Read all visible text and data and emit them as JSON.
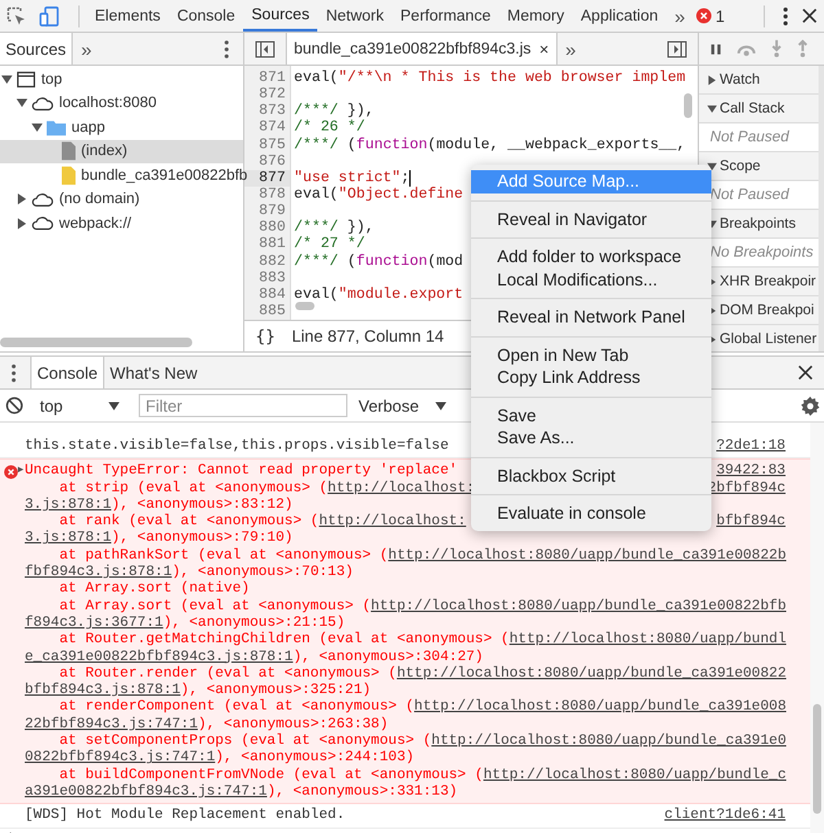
{
  "main_tabs": [
    {
      "label": "Elements",
      "selected": false
    },
    {
      "label": "Console",
      "selected": false
    },
    {
      "label": "Sources",
      "selected": true
    },
    {
      "label": "Network",
      "selected": false
    },
    {
      "label": "Performance",
      "selected": false
    },
    {
      "label": "Memory",
      "selected": false
    },
    {
      "label": "Application",
      "selected": false
    }
  ],
  "more_tabs": "»",
  "error_count": "1",
  "navigator": {
    "tab": "Sources",
    "more": "»",
    "tree": [
      {
        "label": "top",
        "kind": "frame",
        "expanded": true,
        "selected": false,
        "children": [
          {
            "label": "localhost:8080",
            "kind": "cloud",
            "expanded": true,
            "selected": false,
            "children": [
              {
                "label": "uapp",
                "kind": "folder",
                "expanded": true,
                "selected": false,
                "children": [
                  {
                    "label": "(index)",
                    "kind": "document",
                    "selected": true
                  },
                  {
                    "label": "bundle_ca391e00822bfb",
                    "kind": "script",
                    "selected": false
                  }
                ]
              }
            ]
          },
          {
            "label": "(no domain)",
            "kind": "cloud",
            "expanded": false,
            "selected": false
          },
          {
            "label": "webpack://",
            "kind": "cloud",
            "expanded": false,
            "selected": false
          }
        ]
      }
    ]
  },
  "editor": {
    "file_tab": "bundle_ca391e00822bfbf894c3.js",
    "close": "×",
    "more": "»",
    "lines": [
      {
        "number": "871",
        "cursor": false,
        "segments": [
          {
            "kind": "plain",
            "text": "eval("
          },
          {
            "kind": "string",
            "text": "\"/**\\n * This is the web browser implem"
          }
        ]
      },
      {
        "number": "872",
        "cursor": false
      },
      {
        "number": "873",
        "cursor": false,
        "segments": [
          {
            "kind": "comment",
            "text": "/***/"
          },
          {
            "kind": "plain",
            "text": " }),"
          }
        ]
      },
      {
        "number": "874",
        "cursor": false,
        "segments": [
          {
            "kind": "comment",
            "text": "/* 26 */"
          }
        ]
      },
      {
        "number": "875",
        "cursor": false,
        "segments": [
          {
            "kind": "comment",
            "text": "/***/"
          },
          {
            "kind": "plain",
            "text": " ("
          },
          {
            "kind": "keyword",
            "text": "function"
          },
          {
            "kind": "plain",
            "text": "(module, __webpack_exports__,"
          }
        ]
      },
      {
        "number": "876",
        "cursor": false
      },
      {
        "number": "877",
        "cursor": true,
        "segments": [
          {
            "kind": "string",
            "text": "\"use strict\""
          },
          {
            "kind": "plain",
            "text": ";"
          }
        ]
      },
      {
        "number": "878",
        "cursor": false,
        "segments": [
          {
            "kind": "plain",
            "text": "eval("
          },
          {
            "kind": "string",
            "text": "\"Object.define"
          }
        ]
      },
      {
        "number": "879",
        "cursor": false
      },
      {
        "number": "880",
        "cursor": false,
        "segments": [
          {
            "kind": "comment",
            "text": "/***/"
          },
          {
            "kind": "plain",
            "text": " }),"
          }
        ]
      },
      {
        "number": "881",
        "cursor": false,
        "segments": [
          {
            "kind": "comment",
            "text": "/* 27 */"
          }
        ]
      },
      {
        "number": "882",
        "cursor": false,
        "segments": [
          {
            "kind": "comment",
            "text": "/***/"
          },
          {
            "kind": "plain",
            "text": " ("
          },
          {
            "kind": "keyword",
            "text": "function"
          },
          {
            "kind": "plain",
            "text": "(mod"
          }
        ]
      },
      {
        "number": "883",
        "cursor": false
      },
      {
        "number": "884",
        "cursor": false,
        "segments": [
          {
            "kind": "plain",
            "text": "eval("
          },
          {
            "kind": "string",
            "text": "\"module.export"
          }
        ]
      },
      {
        "number": "885",
        "cursor": false
      }
    ],
    "format_button": "{}",
    "status": "Line 877, Column 14"
  },
  "debugger": {
    "sections": [
      {
        "kind": "section",
        "label": "Watch",
        "expanded": false
      },
      {
        "kind": "section",
        "label": "Call Stack",
        "expanded": true
      },
      {
        "kind": "placeholder",
        "label": "Not Paused"
      },
      {
        "kind": "section",
        "label": "Scope",
        "expanded": true
      },
      {
        "kind": "placeholder",
        "label": "Not Paused"
      },
      {
        "kind": "section",
        "label": "Breakpoints",
        "expanded": true
      },
      {
        "kind": "placeholder",
        "label": "No Breakpoints"
      },
      {
        "kind": "section",
        "label": "XHR Breakpoir",
        "expanded": false
      },
      {
        "kind": "section",
        "label": "DOM Breakpoi",
        "expanded": false
      },
      {
        "kind": "section",
        "label": "Global Listener",
        "expanded": false
      }
    ]
  },
  "context_menu": [
    [
      {
        "label": "Add Source Map...",
        "selected": true
      }
    ],
    [
      {
        "label": "Reveal in Navigator",
        "selected": false
      }
    ],
    [
      {
        "label": "Add folder to workspace",
        "selected": false
      },
      {
        "label": "Local Modifications...",
        "selected": false
      }
    ],
    [
      {
        "label": "Reveal in Network Panel",
        "selected": false
      }
    ],
    [
      {
        "label": "Open in New Tab",
        "selected": false
      },
      {
        "label": "Copy Link Address",
        "selected": false
      }
    ],
    [
      {
        "label": "Save",
        "selected": false
      },
      {
        "label": "Save As...",
        "selected": false
      }
    ],
    [
      {
        "label": "Blackbox Script",
        "selected": false
      }
    ],
    [
      {
        "label": "Evaluate in console",
        "selected": false
      }
    ]
  ],
  "drawer": {
    "tabs": [
      {
        "label": "Console",
        "selected": true
      },
      {
        "label": "What's New",
        "selected": false
      }
    ],
    "context": "top",
    "filter": {
      "placeholder": "Filter"
    },
    "level": "Verbose",
    "messages": [
      {
        "kind": "log",
        "lines": [
          {
            "segments": [
              {
                "text": "this.state.visible=false,this.props.visible=false",
                "link": false
              }
            ],
            "right": "?2de1:18"
          }
        ]
      },
      {
        "kind": "error",
        "toggle": "▶",
        "lines": [
          {
            "segments": [
              {
                "text": "Uncaught TypeError: Cannot read property 'replace'",
                "link": false
              }
            ],
            "right": "39422:83"
          },
          {
            "segments": [
              {
                "text": "    at strip (eval at <anonymous> (",
                "link": false
              },
              {
                "text": "http://localhost:",
                "link": true
              }
            ],
            "right": "2bfbf894c"
          },
          {
            "segments": [
              {
                "text": "3.js:878:1",
                "link": true
              },
              {
                "text": "), <anonymous>:83:12)",
                "link": false
              }
            ]
          },
          {
            "segments": [
              {
                "text": "    at rank (eval at <anonymous> (",
                "link": false
              },
              {
                "text": "http://localhost:",
                "link": true
              }
            ],
            "right": "bfbf894c"
          },
          {
            "segments": [
              {
                "text": "3.js:878:1",
                "link": true
              },
              {
                "text": "), <anonymous>:79:10)",
                "link": false
              }
            ]
          },
          {
            "segments": [
              {
                "text": "    at pathRankSort (eval at <anonymous> (",
                "link": false
              },
              {
                "text": "http://localhost:8080/uapp/bundle_ca391e00822b",
                "link": true
              }
            ]
          },
          {
            "segments": [
              {
                "text": "fbf894c3.js:878:1",
                "link": true
              },
              {
                "text": "), <anonymous>:70:13)",
                "link": false
              }
            ]
          },
          {
            "segments": [
              {
                "text": "    at Array.sort (native)",
                "link": false
              }
            ]
          },
          {
            "segments": [
              {
                "text": "    at Array.sort (eval at <anonymous> (",
                "link": false
              },
              {
                "text": "http://localhost:8080/uapp/bundle_ca391e00822bfb",
                "link": true
              }
            ]
          },
          {
            "segments": [
              {
                "text": "f894c3.js:3677:1",
                "link": true
              },
              {
                "text": "), <anonymous>:21:15)",
                "link": false
              }
            ]
          },
          {
            "segments": [
              {
                "text": "    at Router.getMatchingChildren (eval at <anonymous> (",
                "link": false
              },
              {
                "text": "http://localhost:8080/uapp/bundl",
                "link": true
              }
            ]
          },
          {
            "segments": [
              {
                "text": "e_ca391e00822bfbf894c3.js:878:1",
                "link": true
              },
              {
                "text": "), <anonymous>:304:27)",
                "link": false
              }
            ]
          },
          {
            "segments": [
              {
                "text": "    at Router.render (eval at <anonymous> (",
                "link": false
              },
              {
                "text": "http://localhost:8080/uapp/bundle_ca391e00822",
                "link": true
              }
            ]
          },
          {
            "segments": [
              {
                "text": "bfbf894c3.js:878:1",
                "link": true
              },
              {
                "text": "), <anonymous>:325:21)",
                "link": false
              }
            ]
          },
          {
            "segments": [
              {
                "text": "    at renderComponent (eval at <anonymous> (",
                "link": false
              },
              {
                "text": "http://localhost:8080/uapp/bundle_ca391e008",
                "link": true
              }
            ]
          },
          {
            "segments": [
              {
                "text": "22bfbf894c3.js:747:1",
                "link": true
              },
              {
                "text": "), <anonymous>:263:38)",
                "link": false
              }
            ]
          },
          {
            "segments": [
              {
                "text": "    at setComponentProps (eval at <anonymous> (",
                "link": false
              },
              {
                "text": "http://localhost:8080/uapp/bundle_ca391e0",
                "link": true
              }
            ]
          },
          {
            "segments": [
              {
                "text": "0822bfbf894c3.js:747:1",
                "link": true
              },
              {
                "text": "), <anonymous>:244:103)",
                "link": false
              }
            ]
          },
          {
            "segments": [
              {
                "text": "    at buildComponentFromVNode (eval at <anonymous> (",
                "link": false
              },
              {
                "text": "http://localhost:8080/uapp/bundle_c",
                "link": true
              }
            ]
          },
          {
            "segments": [
              {
                "text": "a391e00822bfbf894c3.js:747:1",
                "link": true
              },
              {
                "text": "), <anonymous>:331:13)",
                "link": false
              }
            ]
          }
        ]
      },
      {
        "kind": "log",
        "lines": [
          {
            "segments": [
              {
                "text": "[WDS] Hot Module Replacement enabled.",
                "link": false
              }
            ],
            "right": "client?1de6:41"
          }
        ]
      }
    ]
  }
}
